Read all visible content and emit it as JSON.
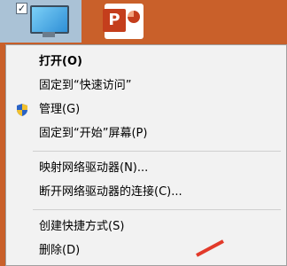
{
  "desktop": {
    "icons": [
      {
        "name": "此电脑",
        "checked": "✓"
      },
      {
        "name": "PowerPoint",
        "badge": "P"
      }
    ]
  },
  "context_menu": {
    "items": [
      {
        "label": "打开(O)",
        "bold": true
      },
      {
        "label": "固定到“快速访问”"
      },
      {
        "label": "管理(G)",
        "icon": "uac-shield-icon"
      },
      {
        "label": "固定到“开始”屏幕(P)"
      },
      {
        "label": "映射网络驱动器(N)..."
      },
      {
        "label": "断开网络驱动器的连接(C)..."
      },
      {
        "label": "创建快捷方式(S)"
      },
      {
        "label": "删除(D)"
      }
    ]
  },
  "colors": {
    "menu_bg": "#f2f2f2",
    "desktop_bg": "#c9602a",
    "ppt_red": "#c43e1c"
  }
}
